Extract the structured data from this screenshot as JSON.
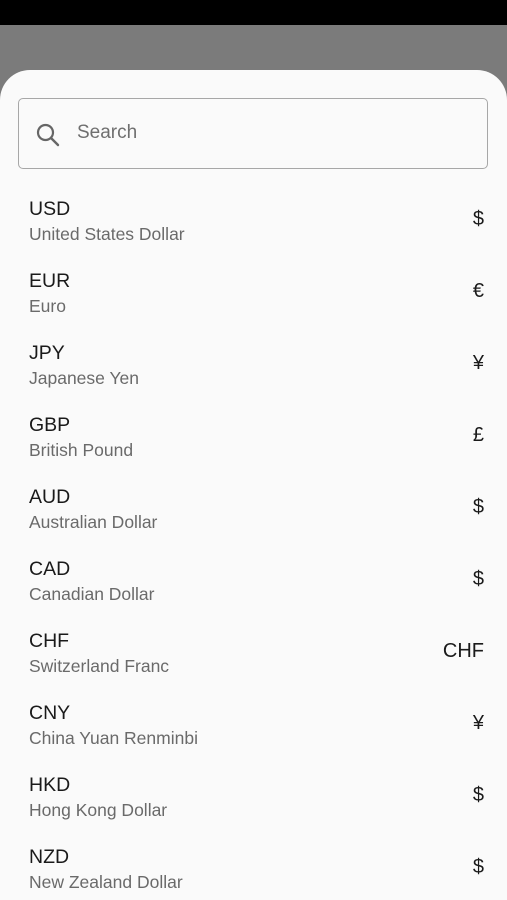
{
  "search": {
    "placeholder": "Search",
    "icon": "search-icon"
  },
  "currencies": [
    {
      "code": "USD",
      "name": "United States Dollar",
      "symbol": "$"
    },
    {
      "code": "EUR",
      "name": "Euro",
      "symbol": "€"
    },
    {
      "code": "JPY",
      "name": "Japanese Yen",
      "symbol": "¥"
    },
    {
      "code": "GBP",
      "name": "British Pound",
      "symbol": "£"
    },
    {
      "code": "AUD",
      "name": "Australian Dollar",
      "symbol": "$"
    },
    {
      "code": "CAD",
      "name": "Canadian Dollar",
      "symbol": "$"
    },
    {
      "code": "CHF",
      "name": "Switzerland Franc",
      "symbol": "CHF"
    },
    {
      "code": "CNY",
      "name": "China Yuan Renminbi",
      "symbol": "¥"
    },
    {
      "code": "HKD",
      "name": "Hong Kong Dollar",
      "symbol": "$"
    },
    {
      "code": "NZD",
      "name": "New Zealand Dollar",
      "symbol": "$"
    }
  ],
  "colors": {
    "status_bar": "#000000",
    "backdrop": "#7b7b7b",
    "sheet": "#fafafa",
    "primary_text": "#1a1a1a",
    "secondary_text": "#6a6a6a"
  }
}
